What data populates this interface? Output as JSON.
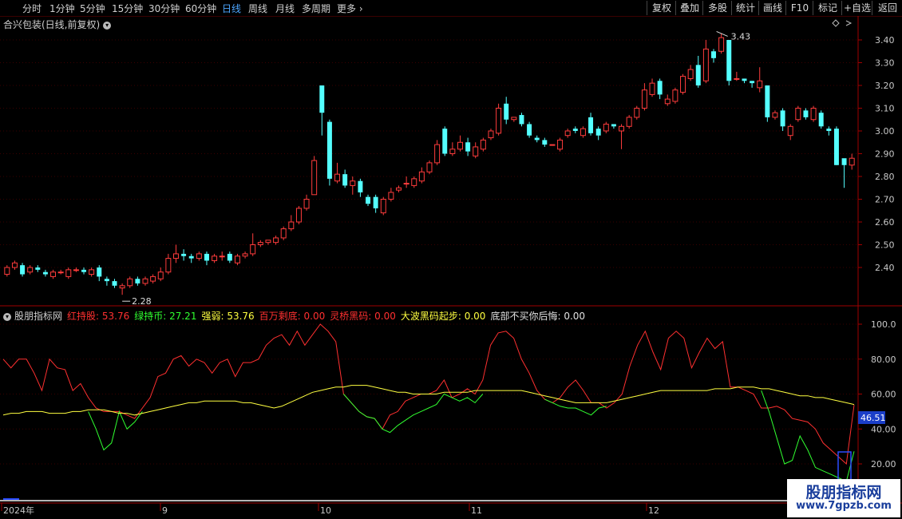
{
  "toolbar": {
    "periods": [
      "分时",
      "1分钟",
      "5分钟",
      "15分钟",
      "30分钟",
      "60分钟",
      "日线",
      "周线",
      "月线",
      "多周期",
      "更多"
    ],
    "active_period": "日线",
    "right_buttons": [
      "复权",
      "叠加",
      "多股",
      "统计",
      "画线",
      "F10",
      "标记",
      "+自选",
      "返回"
    ]
  },
  "main": {
    "title": "合兴包装(日线,前复权)",
    "price_ticks": [
      "3.40",
      "3.30",
      "3.20",
      "3.10",
      "3.00",
      "2.90",
      "2.80",
      "2.70",
      "2.60",
      "2.50",
      "2.40"
    ],
    "high_label": "3.43",
    "low_label": "2.28"
  },
  "indicator": {
    "name": "股朋指标网",
    "items": [
      {
        "label": "红持股:",
        "value": "53.76",
        "color": "#ff3030"
      },
      {
        "label": "绿持币:",
        "value": "27.21",
        "color": "#30ff30"
      },
      {
        "label": "强弱:",
        "value": "53.76",
        "color": "#ffff40"
      },
      {
        "label": "百万剩底:",
        "value": "0.00",
        "color": "#ff3030"
      },
      {
        "label": "灵桥黑码:",
        "value": "0.00",
        "color": "#ff3030"
      },
      {
        "label": "大波黑码起步:",
        "value": "0.00",
        "color": "#ffff40"
      },
      {
        "label": "底部不买你后悔:",
        "value": "0.00",
        "color": "#e0e0e0"
      }
    ],
    "ticks": [
      "100.0",
      "80.00",
      "60.00",
      "40.00",
      "20.00"
    ],
    "current_value": "46.51"
  },
  "xaxis": {
    "labels": [
      "2024年",
      "9",
      "10",
      "11",
      "12"
    ]
  },
  "watermark": {
    "line1": "股朋指标网",
    "line2": "www.7gpzb.com"
  },
  "chart_data": [
    {
      "type": "candlestick",
      "title": "合兴包装(日线,前复权)",
      "ylim": [
        2.22,
        3.5
      ],
      "candles": [
        [
          2.37,
          2.4,
          2.41,
          2.36
        ],
        [
          2.4,
          2.42,
          2.43,
          2.39
        ],
        [
          2.41,
          2.37,
          2.42,
          2.36
        ],
        [
          2.38,
          2.4,
          2.41,
          2.37
        ],
        [
          2.4,
          2.39,
          2.41,
          2.38
        ],
        [
          2.38,
          2.37,
          2.39,
          2.36
        ],
        [
          2.36,
          2.38,
          2.39,
          2.35
        ],
        [
          2.38,
          2.38,
          2.39,
          2.37
        ],
        [
          2.36,
          2.39,
          2.4,
          2.35
        ],
        [
          2.39,
          2.39,
          2.4,
          2.38
        ],
        [
          2.39,
          2.38,
          2.4,
          2.37
        ],
        [
          2.37,
          2.39,
          2.4,
          2.36
        ],
        [
          2.4,
          2.36,
          2.41,
          2.34
        ],
        [
          2.35,
          2.34,
          2.36,
          2.32
        ],
        [
          2.34,
          2.32,
          2.35,
          2.31
        ],
        [
          2.31,
          2.32,
          2.33,
          2.28
        ],
        [
          2.32,
          2.35,
          2.36,
          2.31
        ],
        [
          2.35,
          2.33,
          2.36,
          2.32
        ],
        [
          2.33,
          2.35,
          2.36,
          2.32
        ],
        [
          2.34,
          2.36,
          2.37,
          2.33
        ],
        [
          2.35,
          2.38,
          2.4,
          2.34
        ],
        [
          2.38,
          2.44,
          2.46,
          2.37
        ],
        [
          2.44,
          2.46,
          2.5,
          2.42
        ],
        [
          2.46,
          2.45,
          2.48,
          2.43
        ],
        [
          2.45,
          2.44,
          2.46,
          2.42
        ],
        [
          2.44,
          2.46,
          2.47,
          2.43
        ],
        [
          2.46,
          2.43,
          2.47,
          2.41
        ],
        [
          2.43,
          2.45,
          2.46,
          2.42
        ],
        [
          2.45,
          2.45,
          2.47,
          2.43
        ],
        [
          2.46,
          2.43,
          2.47,
          2.42
        ],
        [
          2.42,
          2.45,
          2.46,
          2.41
        ],
        [
          2.45,
          2.46,
          2.47,
          2.44
        ],
        [
          2.46,
          2.5,
          2.55,
          2.45
        ],
        [
          2.5,
          2.51,
          2.52,
          2.49
        ],
        [
          2.51,
          2.52,
          2.52,
          2.5
        ],
        [
          2.51,
          2.53,
          2.54,
          2.5
        ],
        [
          2.53,
          2.57,
          2.58,
          2.52
        ],
        [
          2.57,
          2.6,
          2.63,
          2.56
        ],
        [
          2.6,
          2.66,
          2.67,
          2.59
        ],
        [
          2.66,
          2.7,
          2.72,
          2.65
        ],
        [
          2.72,
          2.87,
          2.89,
          2.73
        ],
        [
          3.2,
          3.08,
          3.2,
          2.98
        ],
        [
          3.04,
          2.79,
          3.05,
          2.76
        ],
        [
          2.78,
          2.81,
          2.86,
          2.77
        ],
        [
          2.81,
          2.76,
          2.83,
          2.75
        ],
        [
          2.76,
          2.78,
          2.8,
          2.72
        ],
        [
          2.78,
          2.73,
          2.79,
          2.71
        ],
        [
          2.71,
          2.68,
          2.72,
          2.67
        ],
        [
          2.71,
          2.66,
          2.72,
          2.64
        ],
        [
          2.64,
          2.7,
          2.71,
          2.63
        ],
        [
          2.7,
          2.73,
          2.75,
          2.69
        ],
        [
          2.74,
          2.75,
          2.76,
          2.73
        ],
        [
          2.77,
          2.77,
          2.8,
          2.75
        ],
        [
          2.76,
          2.79,
          2.8,
          2.75
        ],
        [
          2.78,
          2.82,
          2.84,
          2.77
        ],
        [
          2.82,
          2.86,
          2.87,
          2.81
        ],
        [
          2.86,
          2.94,
          2.96,
          2.85
        ],
        [
          3.01,
          2.9,
          3.02,
          2.89
        ],
        [
          2.9,
          2.92,
          2.95,
          2.89
        ],
        [
          2.92,
          2.95,
          2.98,
          2.91
        ],
        [
          2.95,
          2.91,
          2.97,
          2.89
        ],
        [
          2.89,
          2.93,
          2.95,
          2.88
        ],
        [
          2.92,
          2.96,
          2.97,
          2.91
        ],
        [
          2.97,
          3.0,
          3.01,
          2.96
        ],
        [
          2.99,
          3.1,
          3.12,
          2.98
        ],
        [
          3.12,
          3.05,
          3.15,
          3.03
        ],
        [
          3.05,
          3.06,
          3.06,
          3.04
        ],
        [
          3.07,
          3.03,
          3.08,
          3.02
        ],
        [
          3.03,
          2.98,
          3.04,
          2.97
        ],
        [
          2.97,
          2.96,
          2.98,
          2.95
        ],
        [
          2.96,
          2.94,
          2.97,
          2.93
        ],
        [
          2.94,
          2.94,
          2.94,
          2.94
        ],
        [
          2.92,
          2.96,
          2.97,
          2.91
        ],
        [
          2.98,
          3.0,
          3.01,
          2.97
        ],
        [
          3.01,
          3.0,
          3.02,
          2.99
        ],
        [
          2.98,
          3.01,
          3.02,
          2.97
        ],
        [
          3.06,
          2.99,
          3.08,
          2.98
        ],
        [
          3.01,
          2.98,
          3.02,
          2.96
        ],
        [
          3.0,
          3.03,
          3.04,
          2.99
        ],
        [
          3.03,
          3.02,
          3.03,
          3.01
        ],
        [
          3.0,
          3.02,
          3.03,
          2.92
        ],
        [
          3.02,
          3.06,
          3.07,
          3.01
        ],
        [
          3.06,
          3.1,
          3.11,
          3.05
        ],
        [
          3.1,
          3.18,
          3.21,
          3.09
        ],
        [
          3.16,
          3.21,
          3.23,
          3.15
        ],
        [
          3.22,
          3.16,
          3.23,
          3.14
        ],
        [
          3.12,
          3.14,
          3.16,
          3.11
        ],
        [
          3.13,
          3.18,
          3.19,
          3.12
        ],
        [
          3.17,
          3.24,
          3.25,
          3.16
        ],
        [
          3.23,
          3.27,
          3.29,
          3.22
        ],
        [
          3.29,
          3.2,
          3.33,
          3.19
        ],
        [
          3.22,
          3.36,
          3.4,
          3.21
        ],
        [
          3.35,
          3.32,
          3.36,
          3.3
        ],
        [
          3.35,
          3.41,
          3.43,
          3.34
        ],
        [
          3.4,
          3.22,
          3.4,
          3.2
        ],
        [
          3.23,
          3.23,
          3.26,
          3.22
        ],
        [
          3.23,
          3.22,
          3.23,
          3.21
        ],
        [
          3.22,
          3.21,
          3.22,
          3.19
        ],
        [
          3.19,
          3.22,
          3.28,
          3.17
        ],
        [
          3.2,
          3.06,
          3.2,
          3.04
        ],
        [
          3.06,
          3.08,
          3.09,
          3.05
        ],
        [
          3.09,
          3.02,
          3.1,
          3.0
        ],
        [
          2.98,
          3.02,
          3.03,
          2.96
        ],
        [
          3.05,
          3.1,
          3.11,
          3.04
        ],
        [
          3.09,
          3.06,
          3.1,
          3.05
        ],
        [
          3.05,
          3.1,
          3.11,
          3.04
        ],
        [
          3.08,
          3.02,
          3.09,
          3.01
        ],
        [
          3.01,
          3.0,
          3.02,
          2.98
        ],
        [
          3.01,
          2.85,
          3.02,
          2.85
        ],
        [
          2.88,
          2.85,
          2.87,
          2.75
        ],
        [
          2.85,
          2.88,
          2.9,
          2.83
        ]
      ]
    },
    {
      "type": "line",
      "ylim": [
        0,
        100
      ],
      "series": [
        {
          "name": "红持股",
          "color": "#ff3030",
          "values": [
            80,
            75,
            80,
            80,
            72,
            62,
            80,
            75,
            74,
            62,
            66,
            58,
            52,
            50,
            50,
            50,
            48,
            46,
            52,
            58,
            70,
            72,
            80,
            82,
            76,
            80,
            78,
            72,
            78,
            80,
            70,
            78,
            78,
            80,
            88,
            92,
            94,
            88,
            96,
            88,
            94,
            100,
            96,
            90,
            60,
            55,
            50,
            47,
            46,
            40,
            48,
            50,
            56,
            58,
            60,
            60,
            62,
            68,
            58,
            60,
            63,
            60,
            68,
            88,
            95,
            96,
            92,
            80,
            72,
            62,
            57,
            55,
            58,
            64,
            68,
            62,
            55,
            55,
            52,
            55,
            60,
            76,
            88,
            96,
            84,
            74,
            92,
            96,
            92,
            75,
            84,
            92,
            86,
            90,
            64,
            64,
            62,
            60,
            52,
            52,
            53,
            51,
            46,
            45,
            44,
            40,
            32,
            28,
            24,
            20,
            53.76
          ]
        },
        {
          "name": "绿持币",
          "color": "#30ff30",
          "values": [
            null,
            null,
            null,
            null,
            null,
            null,
            null,
            null,
            null,
            null,
            null,
            50,
            40,
            28,
            32,
            50,
            40,
            44,
            50,
            null,
            null,
            null,
            null,
            null,
            null,
            null,
            null,
            null,
            null,
            null,
            null,
            null,
            null,
            null,
            null,
            null,
            null,
            null,
            null,
            null,
            null,
            null,
            null,
            null,
            60,
            55,
            50,
            47,
            46,
            40,
            38,
            42,
            45,
            48,
            50,
            52,
            54,
            60,
            58,
            56,
            58,
            55,
            60,
            null,
            null,
            null,
            null,
            null,
            null,
            null,
            57,
            55,
            53,
            52,
            52,
            50,
            48,
            52,
            53,
            null,
            null,
            null,
            null,
            null,
            null,
            null,
            null,
            null,
            null,
            null,
            null,
            null,
            null,
            null,
            null,
            null,
            null,
            null,
            62,
            50,
            35,
            20,
            22,
            36,
            28,
            18,
            16,
            14,
            12,
            10,
            27.21
          ]
        },
        {
          "name": "强弱",
          "color": "#ffff40",
          "values": [
            48,
            49,
            49,
            50,
            50,
            50,
            49,
            49,
            49,
            50,
            50,
            51,
            51,
            51,
            50,
            49,
            49,
            48,
            49,
            50,
            51,
            52,
            53,
            54,
            55,
            55,
            56,
            56,
            56,
            56,
            56,
            55,
            55,
            54,
            53,
            52,
            53,
            55,
            57,
            59,
            61,
            62,
            63,
            64,
            64,
            65,
            65,
            65,
            64,
            63,
            62,
            61,
            61,
            60,
            60,
            60,
            60,
            61,
            61,
            61,
            61,
            62,
            62,
            62,
            62,
            62,
            62,
            62,
            61,
            60,
            59,
            58,
            57,
            56,
            55,
            55,
            55,
            55,
            55,
            56,
            57,
            58,
            59,
            60,
            61,
            62,
            62,
            62,
            62,
            62,
            62,
            62,
            63,
            63,
            63,
            64,
            64,
            64,
            63,
            63,
            62,
            61,
            60,
            59,
            59,
            58,
            58,
            57,
            56,
            55,
            54
          ]
        }
      ]
    }
  ]
}
